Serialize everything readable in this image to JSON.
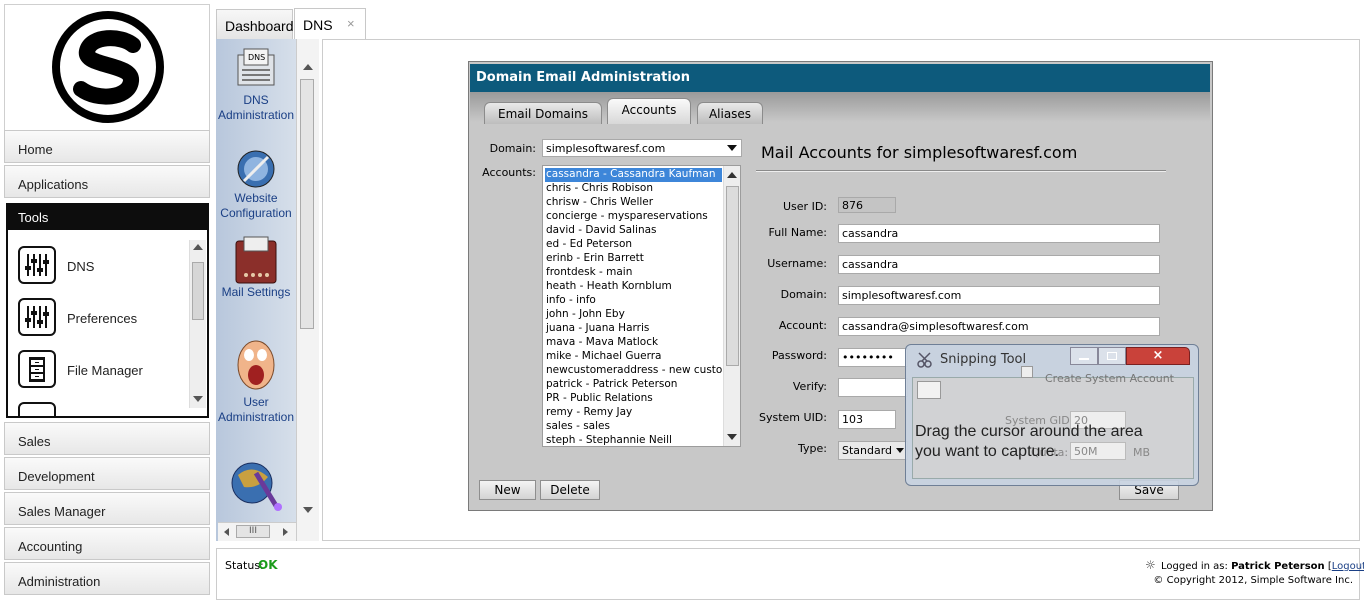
{
  "nav": {
    "home": "Home",
    "applications": "Applications",
    "tools": "Tools",
    "tools_items": [
      {
        "label": "DNS",
        "icon": "sliders-icon"
      },
      {
        "label": "Preferences",
        "icon": "sliders-icon"
      },
      {
        "label": "File Manager",
        "icon": "file-cabinet-icon"
      }
    ],
    "sales": "Sales",
    "development": "Development",
    "sales_manager": "Sales Manager",
    "accounting": "Accounting",
    "administration": "Administration"
  },
  "tabs": {
    "dashboard": "Dashboard",
    "dns": "DNS",
    "close": "×"
  },
  "rail": {
    "items": [
      {
        "label": "DNS Administration",
        "icon": "dns-icon"
      },
      {
        "label": "Website Configuration",
        "icon": "compass-globe-icon"
      },
      {
        "label": "Mail Settings",
        "icon": "mailbox-icon"
      },
      {
        "label": "User Administration",
        "icon": "screaming-face-icon"
      },
      {
        "label": "",
        "icon": "wizard-globe-icon"
      }
    ],
    "h_scroll_grip": "III"
  },
  "window": {
    "title": "Domain Email Administration",
    "tabs": [
      "Email Domains",
      "Accounts",
      "Aliases"
    ],
    "domain_label": "Domain:",
    "domain_value": "simplesoftwaresf.com",
    "accounts_label": "Accounts:",
    "accounts": [
      "cassandra - Cassandra Kaufman",
      "chris - Chris Robison",
      "chrisw - Chris Weller",
      "concierge - myspareservations",
      "david - David Salinas",
      "ed - Ed Peterson",
      "erinb - Erin Barrett",
      "frontdesk - main",
      "heath - Heath Kornblum",
      "info - info",
      "john - John Eby",
      "juana - Juana Harris",
      "mava - Mava Matlock",
      "mike - Michael Guerra",
      "newcustomeraddress - new custon",
      "patrick - Patrick Peterson",
      "PR - Public Relations",
      "remy - Remy Jay",
      "sales - sales",
      "steph - Stephannie Neill"
    ],
    "heading": "Mail Accounts for simplesoftwaresf.com",
    "user_id_label": "User ID:",
    "user_id_value": "876",
    "full_name_label": "Full Name:",
    "full_name_value": "cassandra",
    "username_label": "Username:",
    "username_value": "cassandra",
    "domain2_label": "Domain:",
    "domain2_value": "simplesoftwaresf.com",
    "account_label": "Account:",
    "account_value": "cassandra@simplesoftwaresf.com",
    "password_label": "Password:",
    "password_value": "••••••••",
    "verify_label": "Verify:",
    "system_uid_label": "System UID:",
    "system_uid_value": "103",
    "type_label": "Type:",
    "type_value": "Standard",
    "new_button": "New",
    "delete_button": "Delete",
    "save_button": "Save"
  },
  "snip": {
    "title": "Snipping Tool",
    "create_system_account": "Create System Account",
    "system_gid_label": "System GID:",
    "system_gid_value": "20",
    "quota_label": "Quota:",
    "quota_value": "50M",
    "quota_unit": "MB",
    "message_line1": "Drag the cursor around the area",
    "message_line2": "you want to capture."
  },
  "footer": {
    "status_label": "Status:",
    "status_value": "OK",
    "logged_in_label": "Logged in as:",
    "user_name": "Patrick Peterson",
    "logout": "Logout",
    "copyright": "© Copyright 2012, Simple Software Inc."
  },
  "colors": {
    "title_bar": "#0d5a7c",
    "rail": "#c4d1e2",
    "status_ok": "#1a9c1a",
    "link": "#1a3f85"
  }
}
